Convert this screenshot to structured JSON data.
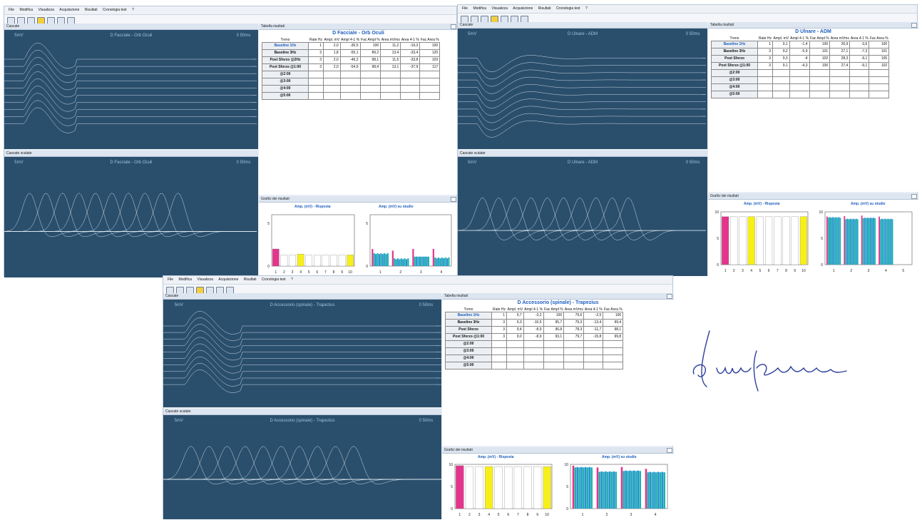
{
  "app": {
    "menu": [
      "File",
      "Modifica",
      "Visualizza",
      "Acquisizione",
      "Risultati",
      "Cronologia test",
      "?"
    ],
    "panels": {
      "traces": "Cascate",
      "scaled": "Cascate scalate",
      "table": "Tabella risultati",
      "graphs": "Grafici dei risultati"
    },
    "graph_titles": {
      "response": "Amp. (mV) - Risposta",
      "study": "Amp. (mV) su studio"
    },
    "columns": [
      "Treno",
      "Rate Hz",
      "Ampl. mV",
      "Ampl 4-1 %",
      "Fac Ampl %",
      "Area mVms",
      "Area 4-1 %",
      "Fac Area %"
    ],
    "colors": {
      "trace_bg": "#2a4f6d",
      "trace_line": "#e6eef6",
      "accent": "#1f5fbf",
      "magenta": "#e4348c",
      "yellow": "#f7ef1a",
      "teal": "#19b3ad"
    }
  },
  "windows": [
    {
      "id": "orb",
      "title": "D Facciale - Orb Oculi",
      "trace_labels": [
        "5mV",
        "D Facciale - Orb Oculi",
        "0 50ms"
      ],
      "scaled_labels": [
        "5mV",
        "D Facciale - Orb Oculi",
        "0 50ms"
      ],
      "rows": [
        {
          "treno": "Baseline 1Hz",
          "rate": "1",
          "ampl": "2,0",
          "a41": "-30,5",
          "fac_ampl": "100",
          "area": "11,2",
          "ar41": "-19,3",
          "fac_area": "100"
        },
        {
          "treno": "Baseline 3Hz",
          "rate": "3",
          "ampl": "1,8",
          "a41": "-55,1",
          "fac_ampl": "89,2",
          "area": "13,4",
          "ar41": "-33,4",
          "fac_area": "120"
        },
        {
          "treno": "Post Sforzo @2Hz",
          "rate": "3",
          "ampl": "2,0",
          "a41": "-46,2",
          "fac_ampl": "98,1",
          "area": "11,5",
          "ar41": "-33,8",
          "fac_area": "103"
        },
        {
          "treno": "Post Sforzo @1:00",
          "rate": "3",
          "ampl": "2,0",
          "a41": "-54,9",
          "fac_ampl": "98,4",
          "area": "13,1",
          "ar41": "-37,9",
          "fac_area": "117"
        },
        {
          "treno": "@2:00"
        },
        {
          "treno": "@3:00"
        },
        {
          "treno": "@4:00"
        },
        {
          "treno": "@5:00"
        }
      ],
      "chart_data": [
        {
          "type": "bar",
          "title": "Amp. (mV) - Risposta",
          "categories": [
            "1",
            "2",
            "3",
            "4",
            "5",
            "6",
            "7",
            "8",
            "9",
            "10"
          ],
          "values": [
            2.0,
            1.3,
            1.3,
            1.4,
            1.3,
            1.3,
            1.3,
            1.3,
            1.3,
            1.3
          ],
          "ylim": [
            0,
            6
          ],
          "yticks": [
            "5",
            "0"
          ]
        },
        {
          "type": "bar",
          "title": "Amp. (mV) su studio",
          "categories": [
            "1",
            "2",
            "3",
            "4"
          ],
          "series": [
            {
              "values": [
                2.0,
                1.8,
                2.0,
                2.0
              ]
            },
            {
              "values": [
                1.4,
                0.8,
                1.1,
                0.9
              ]
            },
            {
              "values": [
                1.5,
                0.9,
                1.1,
                1.0
              ]
            }
          ],
          "ylim": [
            0,
            6
          ],
          "yticks": [
            "5",
            "0"
          ]
        }
      ]
    },
    {
      "id": "adm",
      "title": "D Ulnare - ADM",
      "trace_labels": [
        "5mV",
        "D Ulnare - ADM",
        "0 50ms"
      ],
      "scaled_labels": [
        "5mV",
        "D Ulnare - ADM",
        "0 50ms"
      ],
      "rows": [
        {
          "treno": "Baseline 1Hz",
          "rate": "1",
          "ampl": "9,1",
          "a41": "-1,4",
          "fac_ampl": "100",
          "area": "26,9",
          "ar41": "-3,6",
          "fac_area": "100"
        },
        {
          "treno": "Baseline 3Hz",
          "rate": "3",
          "ampl": "9,2",
          "a41": "-5,9",
          "fac_ampl": "101",
          "area": "27,1",
          "ar41": "-7,3",
          "fac_area": "101"
        },
        {
          "treno": "Post Sforzo",
          "rate": "3",
          "ampl": "9,3",
          "a41": "-4",
          "fac_ampl": "102",
          "area": "28,3",
          "ar41": "-9,1",
          "fac_area": "105"
        },
        {
          "treno": "Post Sforzo @1:00",
          "rate": "3",
          "ampl": "9,1",
          "a41": "-4,3",
          "fac_ampl": "100",
          "area": "27,4",
          "ar41": "-9,1",
          "fac_area": "102"
        },
        {
          "treno": "@2:00"
        },
        {
          "treno": "@3:00"
        },
        {
          "treno": "@4:00"
        },
        {
          "treno": "@5:00"
        }
      ],
      "chart_data": [
        {
          "type": "bar",
          "title": "Amp. (mV) - Risposta",
          "categories": [
            "1",
            "2",
            "3",
            "4",
            "5",
            "6",
            "7",
            "8",
            "9",
            "10"
          ],
          "values": [
            9.1,
            9.1,
            9.1,
            9.1,
            9.1,
            9.1,
            9.1,
            9.1,
            9.1,
            9.1
          ],
          "ylim": [
            0,
            10
          ],
          "yticks": [
            "10",
            "5",
            "0"
          ]
        },
        {
          "type": "bar",
          "title": "Amp. (mV) su studio",
          "categories": [
            "1",
            "2",
            "3",
            "4",
            "5"
          ],
          "series": [
            {
              "values": [
                9.1,
                9.2,
                9.3,
                9.1
              ]
            },
            {
              "values": [
                9.0,
                8.7,
                8.9,
                8.7
              ]
            },
            {
              "values": [
                8.9,
                8.6,
                8.8,
                8.6
              ]
            }
          ],
          "ylim": [
            0,
            10
          ],
          "yticks": [
            "10",
            "5",
            "0"
          ]
        }
      ]
    },
    {
      "id": "trap",
      "title": "D Accessorio (spinale) - Trapezius",
      "trace_labels": [
        "5mV",
        "D Accessorio (spinale) - Trapezius",
        "0 50ms"
      ],
      "scaled_labels": [
        "5mV",
        "D Accessorio (spinale) - Trapezius",
        "0 50ms"
      ],
      "rows": [
        {
          "treno": "Baseline 1Hz",
          "rate": "1",
          "ampl": "9,7",
          "a41": "-3,2",
          "fac_ampl": "100",
          "area": "79,6",
          "ar41": "-2,5",
          "fac_area": "100"
        },
        {
          "treno": "Baseline 3Hz",
          "rate": "3",
          "ampl": "9,3",
          "a41": "-10,5",
          "fac_ampl": "95,7",
          "area": "79,3",
          "ar41": "-13,4",
          "fac_area": "99,4"
        },
        {
          "treno": "Post Sforzo",
          "rate": "3",
          "ampl": "9,4",
          "a41": "-8,9",
          "fac_ampl": "96,8",
          "area": "78,3",
          "ar41": "-11,7",
          "fac_area": "98,1"
        },
        {
          "treno": "Post Sforzo @1:00",
          "rate": "3",
          "ampl": "9,0",
          "a41": "-8,9",
          "fac_ampl": "93,1",
          "area": "79,7",
          "ar41": "-15,8",
          "fac_area": "99,8"
        },
        {
          "treno": "@2:00"
        },
        {
          "treno": "@3:00"
        },
        {
          "treno": "@4:00"
        },
        {
          "treno": "@5:00"
        }
      ],
      "chart_data": [
        {
          "type": "bar",
          "title": "Amp. (mV) - Risposta",
          "categories": [
            "1",
            "2",
            "3",
            "4",
            "5",
            "6",
            "7",
            "8",
            "9",
            "10"
          ],
          "values": [
            9.7,
            9.5,
            9.5,
            9.5,
            9.5,
            9.5,
            9.5,
            9.5,
            9.5,
            9.5
          ],
          "ylim": [
            0,
            10
          ],
          "yticks": [
            "10",
            "5",
            "0"
          ]
        },
        {
          "type": "bar",
          "title": "Amp. (mV) su studio",
          "categories": [
            "1",
            "2",
            "3",
            "4"
          ],
          "series": [
            {
              "values": [
                9.7,
                9.3,
                9.4,
                9.0
              ]
            },
            {
              "values": [
                9.4,
                8.4,
                8.6,
                8.3
              ]
            },
            {
              "values": [
                9.3,
                8.3,
                8.5,
                8.2
              ]
            }
          ],
          "ylim": [
            0,
            10
          ],
          "yticks": [
            "10",
            "5",
            "0"
          ]
        }
      ]
    }
  ]
}
